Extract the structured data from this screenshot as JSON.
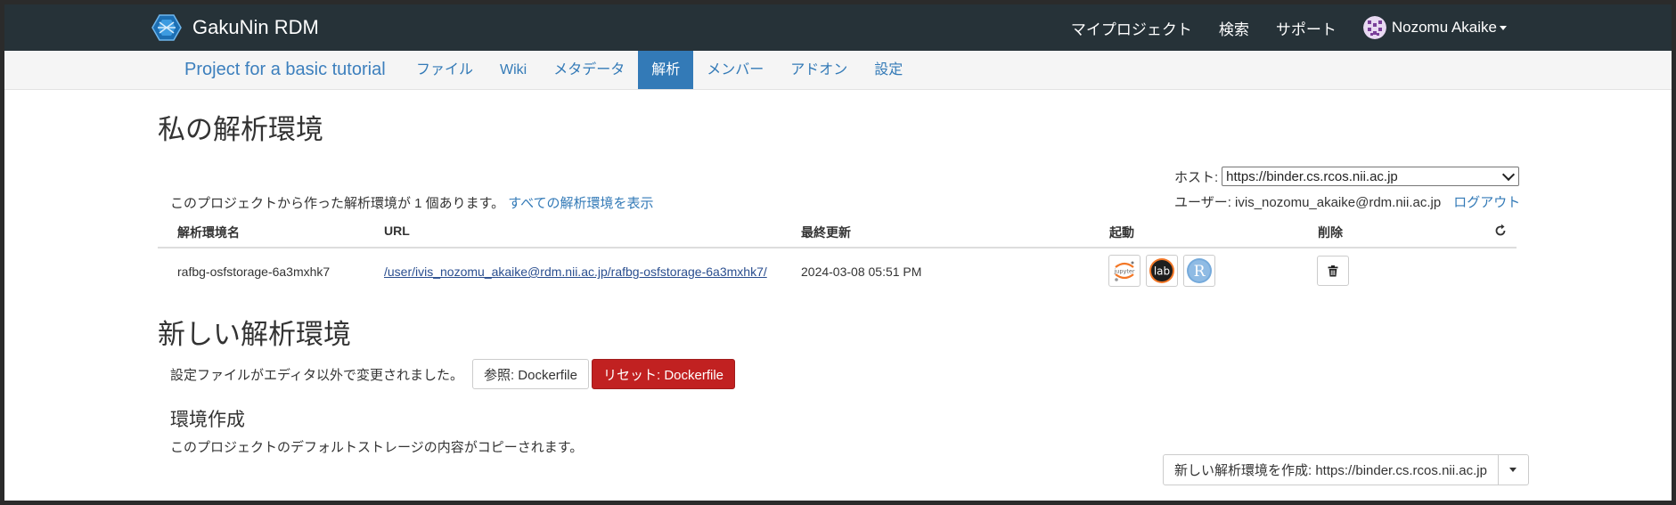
{
  "app": {
    "name": "GakuNin RDM"
  },
  "navbar": {
    "links": [
      "マイプロジェクト",
      "検索",
      "サポート"
    ],
    "user_name": "Nozomu Akaike"
  },
  "project": {
    "title": "Project for a basic tutorial",
    "tabs": [
      "ファイル",
      "Wiki",
      "メタデータ",
      "解析",
      "メンバー",
      "アドオン",
      "設定"
    ],
    "active_tab": "解析"
  },
  "my_envs": {
    "heading": "私の解析環境",
    "host_label": "ホスト:",
    "host_value": "https://binder.cs.rcos.nii.ac.jp",
    "count_text": "このプロジェクトから作った解析環境が 1 個あります。",
    "show_all_link": "すべての解析環境を表示",
    "user_label": "ユーザー: ivis_nozomu_akaike@rdm.nii.ac.jp",
    "logout": "ログアウト",
    "columns": [
      "解析環境名",
      "URL",
      "最終更新",
      "起動",
      "削除"
    ],
    "rows": [
      {
        "name": "rafbg-osfstorage-6a3mxhk7",
        "url": "/user/ivis_nozomu_akaike@rdm.nii.ac.jp/rafbg-osfstorage-6a3mxhk7/",
        "updated": "2024-03-08 05:51 PM",
        "launchers": [
          {
            "icon": "jupyter-icon",
            "label": "jupyter"
          },
          {
            "icon": "jupyterlab-icon",
            "label": "lab"
          },
          {
            "icon": "rstudio-icon",
            "label": "R"
          }
        ]
      }
    ]
  },
  "new_env": {
    "heading": "新しい解析環境",
    "modified_text": "設定ファイルがエディタ以外で変更されました。",
    "view_button": "参照: Dockerfile",
    "reset_button": "リセット: Dockerfile",
    "create_title": "環境作成",
    "create_desc": "このプロジェクトのデフォルトストレージの内容がコピーされます。",
    "create_button": "新しい解析環境を作成: https://binder.cs.rcos.nii.ac.jp"
  },
  "colors": {
    "navbar_bg": "#263238",
    "accent": "#337ab7",
    "danger": "#c12121"
  }
}
